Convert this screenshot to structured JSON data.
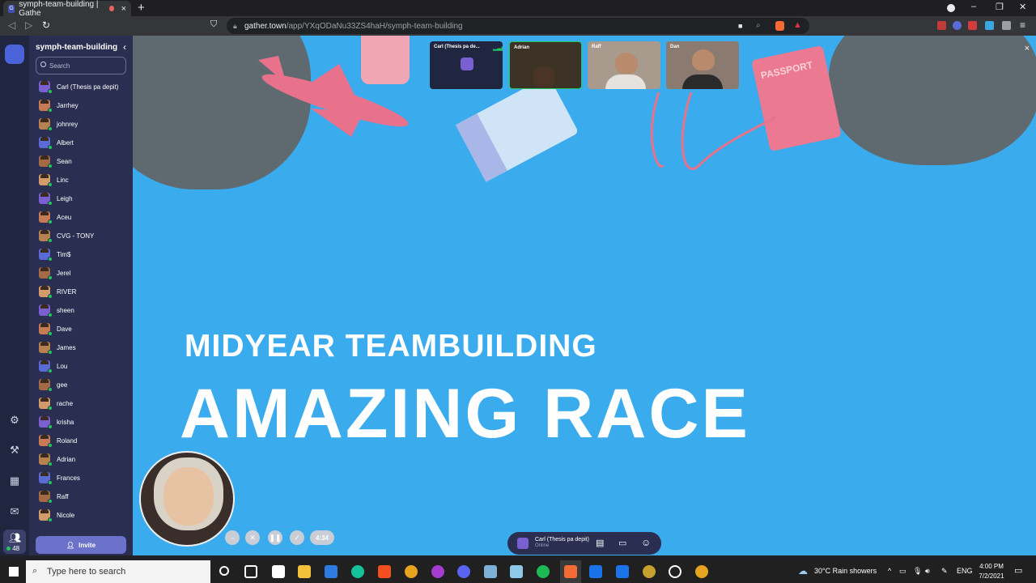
{
  "browser": {
    "tab_title": "symph-team-building | Gathe",
    "tab_close": "×",
    "new_tab": "+",
    "url_domain": "gather.town",
    "url_path": "/app/YXqODaNu33ZS4haH/symph-team-building",
    "window_controls": [
      "–",
      "❐",
      "✕"
    ]
  },
  "sidebar": {
    "space_name": "symph-team-building",
    "close_label": "‹",
    "search_placeholder": "Search",
    "members": [
      "Carl (Thesis pa depit)",
      "Jarrhey",
      "johnrey",
      "Albert",
      "Sean",
      "Linc",
      "Leigh",
      "Aceu",
      "CVG - TONY",
      "Tim$",
      "Jerel",
      "RIVER",
      "sheen",
      "Dave",
      "James",
      "Lou",
      "gee",
      "rache",
      "krisha",
      "Roland",
      "Adrian",
      "Frances",
      "Raff",
      "Nicole"
    ],
    "invite_label": "Invite",
    "participant_count": "48"
  },
  "stage": {
    "title_small": "MIDYEAR TEAMBUILDING",
    "title_large": "AMAZING RACE",
    "passport_text": "PASSPORT",
    "close_label": "×"
  },
  "video_tiles": [
    {
      "name": "Carl (Thesis pa de..."
    },
    {
      "name": "Adrian"
    },
    {
      "name": "Raff"
    },
    {
      "name": "Dan"
    }
  ],
  "self_controls": {
    "timer": "4:34"
  },
  "bottom_bar": {
    "user_name": "Carl (Thesis pa depit)",
    "status": "Online"
  },
  "taskbar": {
    "search_placeholder": "Type here to search",
    "weather": "30°C  Rain showers",
    "language": "ENG",
    "time": "4:00 PM",
    "date": "7/2/2021"
  },
  "colors": {
    "stage_bg": "#3aabec",
    "sidebar_bg": "#2a2f52",
    "rail_bg": "#202540",
    "invite_bg": "#6c72c9",
    "online": "#22c55e"
  }
}
